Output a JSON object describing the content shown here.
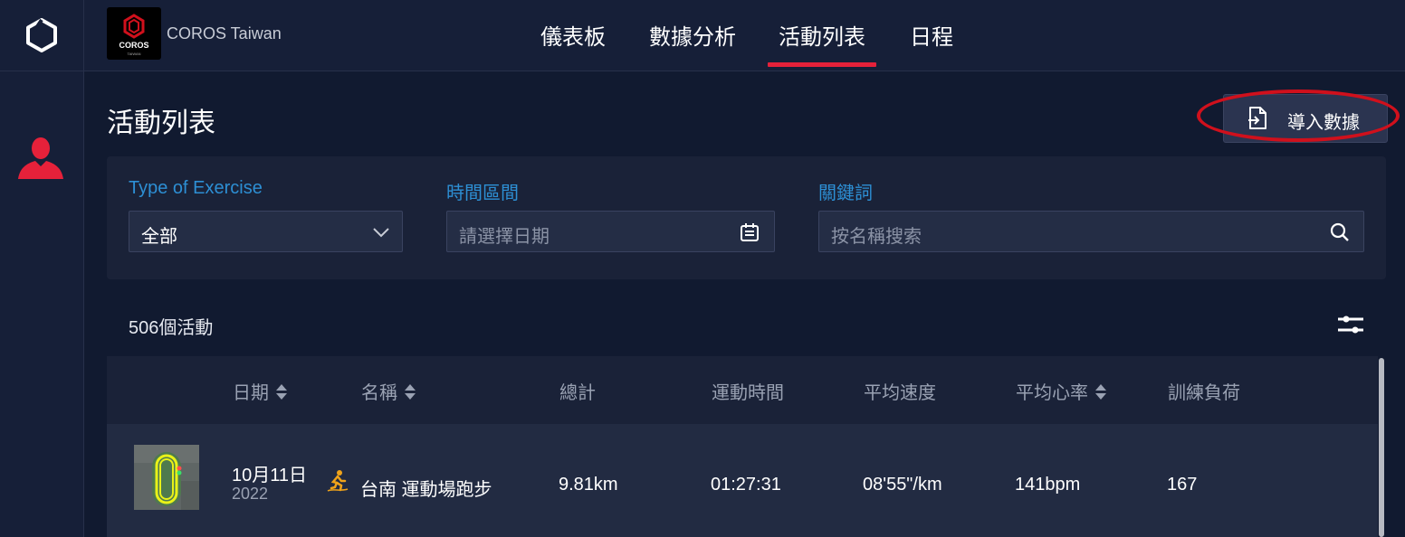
{
  "brand": {
    "name": "COROS Taiwan",
    "logo_text": "COROS",
    "logo_sub": "TAIWAN"
  },
  "nav": {
    "items": [
      "儀表板",
      "數據分析",
      "活動列表",
      "日程"
    ],
    "active": "活動列表"
  },
  "page": {
    "title": "活動列表"
  },
  "import_button": {
    "label": "導入數據"
  },
  "filters": {
    "exercise": {
      "label": "Type of Exercise",
      "value": "全部"
    },
    "date": {
      "label": "時間區間",
      "placeholder": "請選擇日期"
    },
    "keyword": {
      "label": "關鍵詞",
      "placeholder": "按名稱搜索"
    }
  },
  "activity_count": "506個活動",
  "table": {
    "headers": {
      "date": "日期",
      "name": "名稱",
      "total": "總計",
      "time": "運動時間",
      "pace": "平均速度",
      "hr": "平均心率",
      "load": "訓練負荷"
    },
    "rows": [
      {
        "date": "10月11日",
        "year": "2022",
        "name": "台南 運動場跑步",
        "total": "9.81km",
        "time": "01:27:31",
        "pace": "08'55\"/km",
        "hr": "141bpm",
        "load": "167"
      }
    ]
  },
  "colors": {
    "accent_red": "#e5213a",
    "label_blue": "#2d8fd4",
    "highlight_circle": "#d0101c"
  },
  "icons": [
    "coros-logo-icon",
    "user-icon",
    "import-icon",
    "chevron-down-icon",
    "calendar-icon",
    "search-icon",
    "sliders-icon",
    "sort-icon",
    "running-icon"
  ]
}
